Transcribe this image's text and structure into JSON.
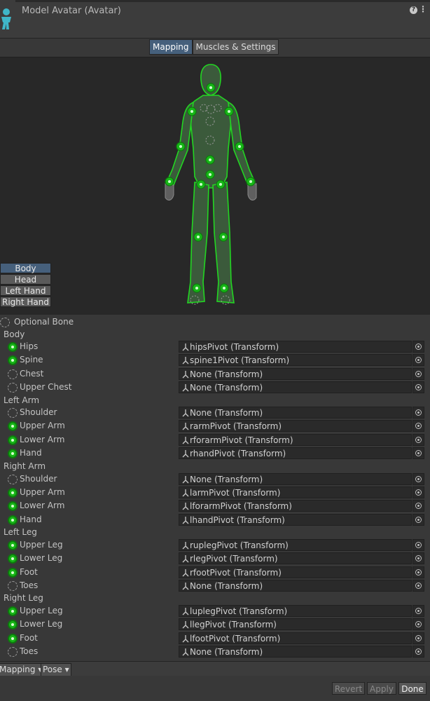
{
  "header": {
    "title": "Model Avatar (Avatar)",
    "help": "?",
    "menu": "⋮"
  },
  "tabs": [
    {
      "label": "Mapping",
      "active": true
    },
    {
      "label": "Muscles & Settings",
      "active": false
    }
  ],
  "body_parts": [
    "Body",
    "Head",
    "Left Hand",
    "Right Hand"
  ],
  "legend": {
    "optional_bone": "Optional Bone"
  },
  "sections": {
    "body": "Body",
    "left_arm": "Left Arm",
    "right_arm": "Right Arm",
    "left_leg": "Left Leg",
    "right_leg": "Right Leg"
  },
  "bones": [
    {
      "label": "Hips",
      "mapped": true,
      "value": "hipsPivot (Transform)"
    },
    {
      "label": "Spine",
      "mapped": true,
      "value": "spine1Pivot (Transform)"
    },
    {
      "label": "Chest",
      "mapped": false,
      "value": "None (Transform)"
    },
    {
      "label": "Upper Chest",
      "mapped": false,
      "value": "None (Transform)"
    },
    {
      "label": "Shoulder",
      "mapped": false,
      "value": "None (Transform)"
    },
    {
      "label": "Upper Arm",
      "mapped": true,
      "value": "rarmPivot (Transform)"
    },
    {
      "label": "Lower Arm",
      "mapped": true,
      "value": "rforarmPivot (Transform)"
    },
    {
      "label": "Hand",
      "mapped": true,
      "value": "rhandPivot (Transform)"
    },
    {
      "label": "Shoulder",
      "mapped": false,
      "value": "None (Transform)"
    },
    {
      "label": "Upper Arm",
      "mapped": true,
      "value": "larmPivot (Transform)"
    },
    {
      "label": "Lower Arm",
      "mapped": true,
      "value": "lforarmPivot (Transform)"
    },
    {
      "label": "Hand",
      "mapped": true,
      "value": "lhandPivot (Transform)"
    },
    {
      "label": "Upper Leg",
      "mapped": true,
      "value": "ruplegPivot (Transform)"
    },
    {
      "label": "Lower Leg",
      "mapped": true,
      "value": "rlegPivot (Transform)"
    },
    {
      "label": "Foot",
      "mapped": true,
      "value": "rfootPivot (Transform)"
    },
    {
      "label": "Toes",
      "mapped": false,
      "value": "None (Transform)"
    },
    {
      "label": "Upper Leg",
      "mapped": true,
      "value": "luplegPivot (Transform)"
    },
    {
      "label": "Lower Leg",
      "mapped": true,
      "value": "llegPivot (Transform)"
    },
    {
      "label": "Foot",
      "mapped": true,
      "value": "lfootPivot (Transform)"
    },
    {
      "label": "Toes",
      "mapped": false,
      "value": "None (Transform)"
    }
  ],
  "bottom": {
    "mapping": "Mapping",
    "pose": "Pose"
  },
  "buttons": {
    "revert": "Revert",
    "apply": "Apply",
    "done": "Done"
  },
  "colors": {
    "mapped": "#17b617",
    "figure_fill": "#3b5a3b",
    "figure_outline": "#22d622",
    "selected": "#46607c"
  }
}
